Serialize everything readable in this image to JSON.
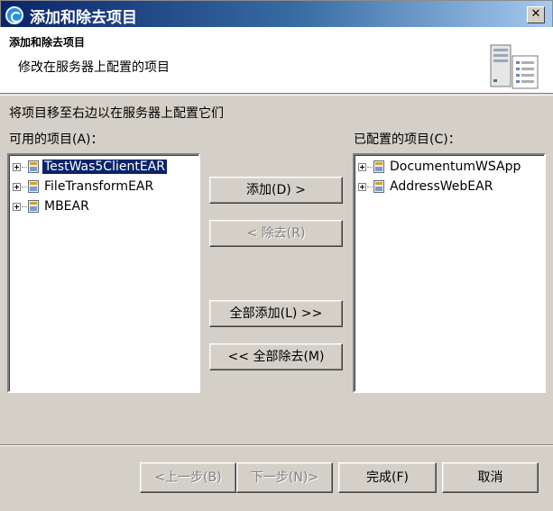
{
  "window": {
    "title": "添加和除去项目",
    "close_label": "✕"
  },
  "header": {
    "title": "添加和除去项目",
    "description": "修改在服务器上配置的项目"
  },
  "instruction": "将项目移至右边以在服务器上配置它们",
  "available": {
    "label": "可用的项目(A)：",
    "items": [
      {
        "label": "TestWas5ClientEAR",
        "selected": true
      },
      {
        "label": "FileTransformEAR",
        "selected": false
      },
      {
        "label": "MBEAR",
        "selected": false
      }
    ]
  },
  "configured": {
    "label": "已配置的项目(C)：",
    "items": [
      {
        "label": "DocumentumWSApp"
      },
      {
        "label": "AddressWebEAR"
      }
    ]
  },
  "buttons": {
    "add": "添加(D) >",
    "remove": "< 除去(R)",
    "add_all": "全部添加(L) >>",
    "remove_all": "<< 全部除去(M)"
  },
  "footer": {
    "back": "<上一步(B)",
    "next": "下一步(N)>",
    "finish": "完成(F)",
    "cancel": "取消"
  },
  "colors": {
    "title_bar_start": "#0a246a",
    "title_bar_end": "#a6caf0",
    "dialog_bg": "#d4d0c8",
    "selection": "#0a246a"
  }
}
